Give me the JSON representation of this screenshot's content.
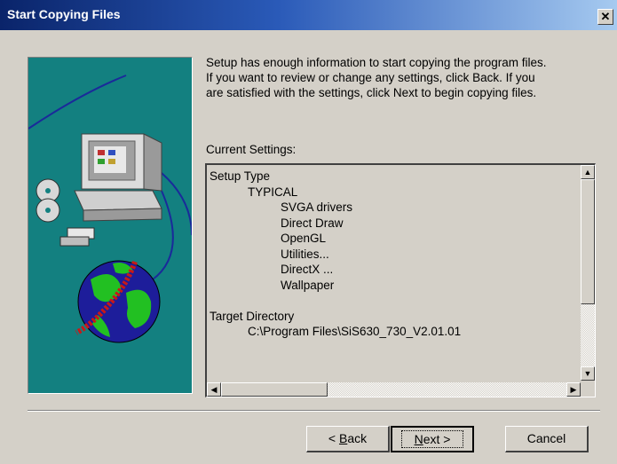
{
  "window": {
    "title": "Start Copying Files",
    "close_glyph": "✕"
  },
  "intro": {
    "line1": "Setup has enough information to start copying the program files.",
    "line2": "If you want to review or change any settings, click Back.  If you",
    "line3": "are satisfied with the settings, click Next to begin copying files."
  },
  "current_settings": {
    "label": "Current Settings:",
    "lines": [
      "Setup Type",
      "TYPICAL",
      "SVGA drivers",
      "Direct Draw",
      "OpenGL",
      "Utilities...",
      "DirectX ...",
      "Wallpaper",
      "",
      "Target Directory",
      "C:\\Program Files\\SiS630_730_V2.01.01"
    ]
  },
  "buttons": {
    "back_prefix": "< ",
    "back_mnemonic": "B",
    "back_rest": "ack",
    "next_mnemonic": "N",
    "next_rest": "ext >",
    "cancel": "Cancel"
  },
  "icons": {
    "close": "close-icon",
    "scroll_up": "arrow-up-icon",
    "scroll_down": "arrow-down-icon",
    "scroll_left": "arrow-left-icon",
    "scroll_right": "arrow-right-icon",
    "illustration": "computer-globe-illustration"
  },
  "colors": {
    "title_gradient_start": "#0a246a",
    "title_gradient_end": "#a6caf0",
    "panel_teal": "#138080",
    "face": "#d4d0c8"
  }
}
